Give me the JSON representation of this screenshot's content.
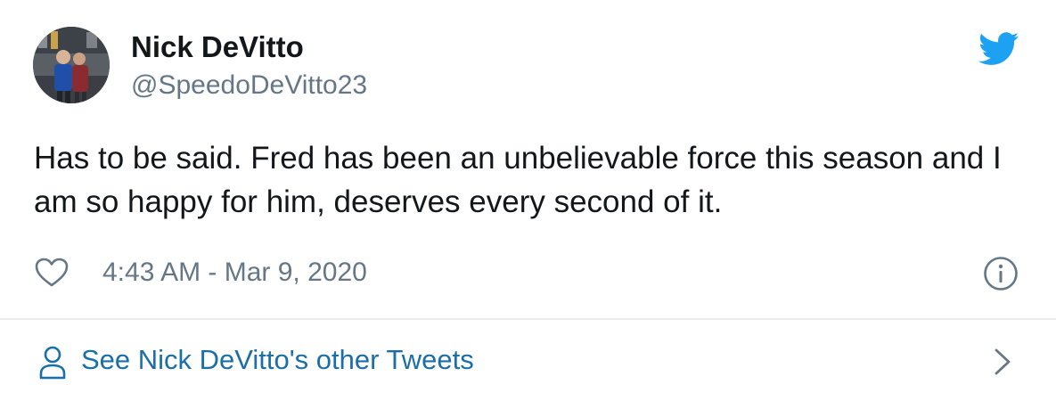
{
  "author": {
    "display_name": "Nick DeVitto",
    "handle": "@SpeedoDeVitto23"
  },
  "tweet": {
    "text": "Has to be said. Fred has been an unbelievable force this season and I am so happy for him, deserves every second of it.",
    "timestamp": "4:43 AM - Mar 9, 2020"
  },
  "footer": {
    "label": "See Nick DeVitto's other Tweets"
  },
  "icons": {
    "brand": "twitter-bird-icon",
    "like": "heart-icon",
    "info": "info-icon",
    "profile": "person-icon",
    "chevron": "chevron-right-icon"
  },
  "colors": {
    "brand": "#1da1f2",
    "link": "#1b6fa8",
    "text_primary": "#14171a",
    "text_secondary": "#657786",
    "divider": "#e6ecf0"
  }
}
